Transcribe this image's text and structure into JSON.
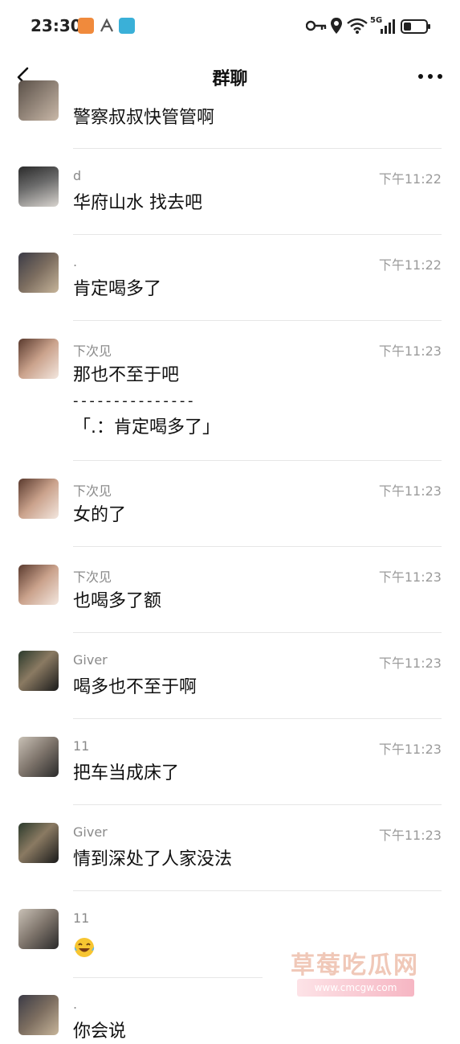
{
  "status_bar": {
    "time": "23:30",
    "network_label": "5G",
    "icons": [
      "notification-app-icon",
      "font-icon",
      "reader-app-icon",
      "key-icon",
      "location-icon",
      "wifi-icon",
      "signal-icon",
      "battery-icon"
    ]
  },
  "header": {
    "title": "群聊",
    "back_icon": "chevron-left-icon",
    "more_icon": "more-dots-icon"
  },
  "messages": [
    {
      "sender": "",
      "time": "",
      "lines": [
        "警察叔叔快管管啊"
      ]
    },
    {
      "sender": "d",
      "time": "下午11:22",
      "lines": [
        "华府山水 找去吧"
      ]
    },
    {
      "sender": ".",
      "time": "下午11:22",
      "lines": [
        "肯定喝多了"
      ]
    },
    {
      "sender": "下次见",
      "time": "下午11:23",
      "lines": [
        "那也不至于吧",
        "- - - - - - - - - - - - - - -",
        "「.：肯定喝多了」"
      ]
    },
    {
      "sender": "下次见",
      "time": "下午11:23",
      "lines": [
        "女的了"
      ]
    },
    {
      "sender": "下次见",
      "time": "下午11:23",
      "lines": [
        "也喝多了额"
      ]
    },
    {
      "sender": "Giver",
      "time": "下午11:23",
      "lines": [
        "喝多也不至于啊"
      ]
    },
    {
      "sender": "11",
      "time": "下午11:23",
      "lines": [
        "把车当成床了"
      ]
    },
    {
      "sender": "Giver",
      "time": "下午11:23",
      "lines": [
        "情到深处了人家没法"
      ]
    },
    {
      "sender": "11",
      "time": "",
      "lines": [],
      "emoji": "laughing-tears-emoji"
    },
    {
      "sender": ".",
      "time": "",
      "lines": [
        "你会说"
      ]
    }
  ],
  "watermark": {
    "title": "草莓吃瓜网",
    "url": "www.cmcgw.com"
  }
}
